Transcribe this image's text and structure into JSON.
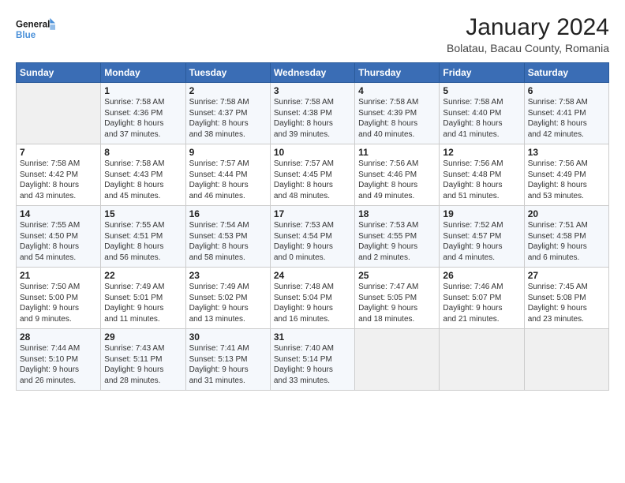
{
  "logo": {
    "line1": "General",
    "line2": "Blue"
  },
  "title": "January 2024",
  "location": "Bolatau, Bacau County, Romania",
  "days_header": [
    "Sunday",
    "Monday",
    "Tuesday",
    "Wednesday",
    "Thursday",
    "Friday",
    "Saturday"
  ],
  "weeks": [
    [
      {
        "day": "",
        "info": ""
      },
      {
        "day": "1",
        "info": "Sunrise: 7:58 AM\nSunset: 4:36 PM\nDaylight: 8 hours\nand 37 minutes."
      },
      {
        "day": "2",
        "info": "Sunrise: 7:58 AM\nSunset: 4:37 PM\nDaylight: 8 hours\nand 38 minutes."
      },
      {
        "day": "3",
        "info": "Sunrise: 7:58 AM\nSunset: 4:38 PM\nDaylight: 8 hours\nand 39 minutes."
      },
      {
        "day": "4",
        "info": "Sunrise: 7:58 AM\nSunset: 4:39 PM\nDaylight: 8 hours\nand 40 minutes."
      },
      {
        "day": "5",
        "info": "Sunrise: 7:58 AM\nSunset: 4:40 PM\nDaylight: 8 hours\nand 41 minutes."
      },
      {
        "day": "6",
        "info": "Sunrise: 7:58 AM\nSunset: 4:41 PM\nDaylight: 8 hours\nand 42 minutes."
      }
    ],
    [
      {
        "day": "7",
        "info": "Sunrise: 7:58 AM\nSunset: 4:42 PM\nDaylight: 8 hours\nand 43 minutes."
      },
      {
        "day": "8",
        "info": "Sunrise: 7:58 AM\nSunset: 4:43 PM\nDaylight: 8 hours\nand 45 minutes."
      },
      {
        "day": "9",
        "info": "Sunrise: 7:57 AM\nSunset: 4:44 PM\nDaylight: 8 hours\nand 46 minutes."
      },
      {
        "day": "10",
        "info": "Sunrise: 7:57 AM\nSunset: 4:45 PM\nDaylight: 8 hours\nand 48 minutes."
      },
      {
        "day": "11",
        "info": "Sunrise: 7:56 AM\nSunset: 4:46 PM\nDaylight: 8 hours\nand 49 minutes."
      },
      {
        "day": "12",
        "info": "Sunrise: 7:56 AM\nSunset: 4:48 PM\nDaylight: 8 hours\nand 51 minutes."
      },
      {
        "day": "13",
        "info": "Sunrise: 7:56 AM\nSunset: 4:49 PM\nDaylight: 8 hours\nand 53 minutes."
      }
    ],
    [
      {
        "day": "14",
        "info": "Sunrise: 7:55 AM\nSunset: 4:50 PM\nDaylight: 8 hours\nand 54 minutes."
      },
      {
        "day": "15",
        "info": "Sunrise: 7:55 AM\nSunset: 4:51 PM\nDaylight: 8 hours\nand 56 minutes."
      },
      {
        "day": "16",
        "info": "Sunrise: 7:54 AM\nSunset: 4:53 PM\nDaylight: 8 hours\nand 58 minutes."
      },
      {
        "day": "17",
        "info": "Sunrise: 7:53 AM\nSunset: 4:54 PM\nDaylight: 9 hours\nand 0 minutes."
      },
      {
        "day": "18",
        "info": "Sunrise: 7:53 AM\nSunset: 4:55 PM\nDaylight: 9 hours\nand 2 minutes."
      },
      {
        "day": "19",
        "info": "Sunrise: 7:52 AM\nSunset: 4:57 PM\nDaylight: 9 hours\nand 4 minutes."
      },
      {
        "day": "20",
        "info": "Sunrise: 7:51 AM\nSunset: 4:58 PM\nDaylight: 9 hours\nand 6 minutes."
      }
    ],
    [
      {
        "day": "21",
        "info": "Sunrise: 7:50 AM\nSunset: 5:00 PM\nDaylight: 9 hours\nand 9 minutes."
      },
      {
        "day": "22",
        "info": "Sunrise: 7:49 AM\nSunset: 5:01 PM\nDaylight: 9 hours\nand 11 minutes."
      },
      {
        "day": "23",
        "info": "Sunrise: 7:49 AM\nSunset: 5:02 PM\nDaylight: 9 hours\nand 13 minutes."
      },
      {
        "day": "24",
        "info": "Sunrise: 7:48 AM\nSunset: 5:04 PM\nDaylight: 9 hours\nand 16 minutes."
      },
      {
        "day": "25",
        "info": "Sunrise: 7:47 AM\nSunset: 5:05 PM\nDaylight: 9 hours\nand 18 minutes."
      },
      {
        "day": "26",
        "info": "Sunrise: 7:46 AM\nSunset: 5:07 PM\nDaylight: 9 hours\nand 21 minutes."
      },
      {
        "day": "27",
        "info": "Sunrise: 7:45 AM\nSunset: 5:08 PM\nDaylight: 9 hours\nand 23 minutes."
      }
    ],
    [
      {
        "day": "28",
        "info": "Sunrise: 7:44 AM\nSunset: 5:10 PM\nDaylight: 9 hours\nand 26 minutes."
      },
      {
        "day": "29",
        "info": "Sunrise: 7:43 AM\nSunset: 5:11 PM\nDaylight: 9 hours\nand 28 minutes."
      },
      {
        "day": "30",
        "info": "Sunrise: 7:41 AM\nSunset: 5:13 PM\nDaylight: 9 hours\nand 31 minutes."
      },
      {
        "day": "31",
        "info": "Sunrise: 7:40 AM\nSunset: 5:14 PM\nDaylight: 9 hours\nand 33 minutes."
      },
      {
        "day": "",
        "info": ""
      },
      {
        "day": "",
        "info": ""
      },
      {
        "day": "",
        "info": ""
      }
    ]
  ]
}
